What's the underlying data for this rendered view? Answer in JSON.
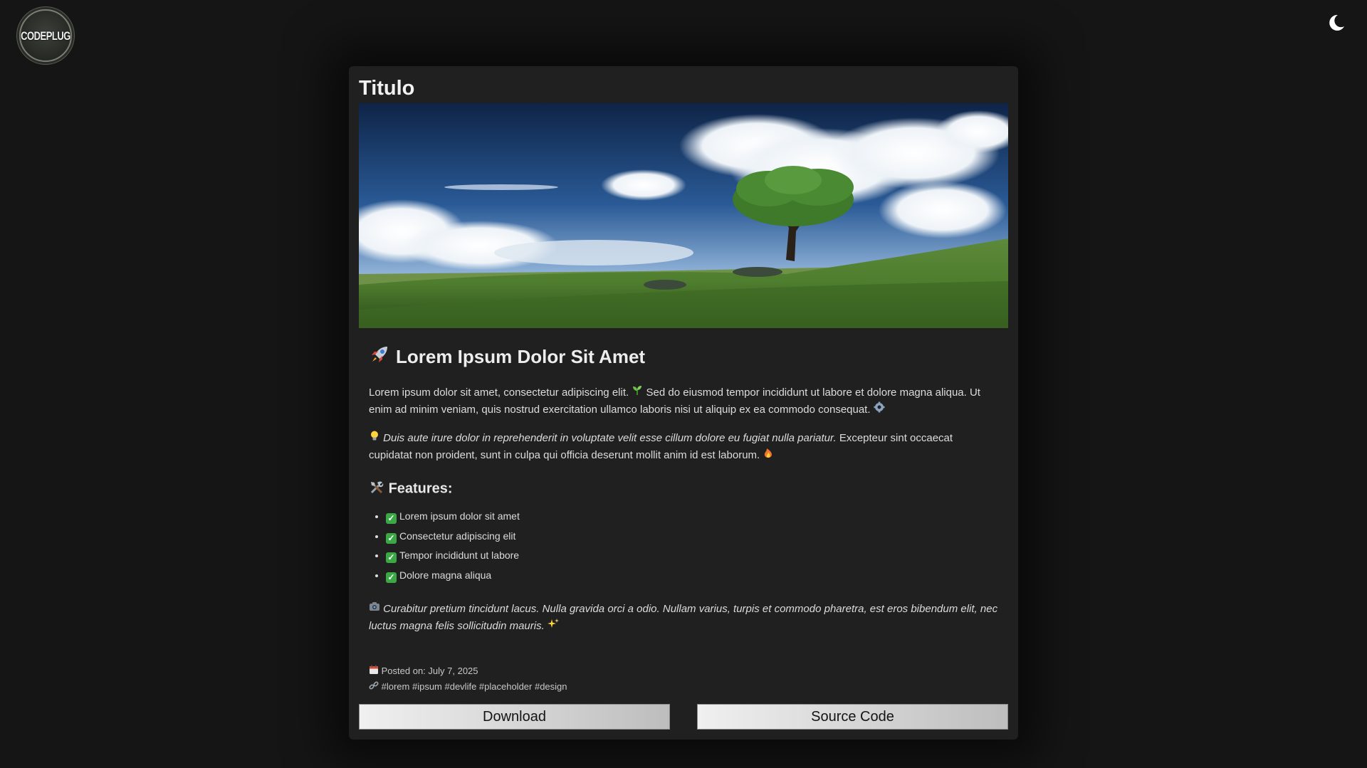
{
  "header": {
    "logo_text": "CODEPLUG",
    "theme_toggle_icon": "moon-icon"
  },
  "card": {
    "title": "Titulo",
    "hero_image": "landscape with tree on grassy hill under blue sky",
    "post": {
      "title": "Lorem Ipsum Dolor Sit Amet",
      "title_icon": "rocket-icon",
      "paragraph1_a": "Lorem ipsum dolor sit amet, consectetur adipiscing elit.",
      "paragraph1_b": "Sed do eiusmod tempor incididunt ut labore et dolore magna aliqua. Ut enim ad minim veniam, quis nostrud exercitation ullamco laboris nisi ut aliquip ex ea commodo consequat.",
      "paragraph2_em": "Duis aute irure dolor in reprehenderit in voluptate velit esse cillum dolore eu fugiat nulla pariatur.",
      "paragraph2_rest": "Excepteur sint occaecat cupidatat non proident, sunt in culpa qui officia deserunt mollit anim id est laborum.",
      "features_title": "Features:",
      "features": [
        "Lorem ipsum dolor sit amet",
        "Consectetur adipiscing elit",
        "Tempor incididunt ut labore",
        "Dolore magna aliqua"
      ],
      "paragraph3_em": "Curabitur pretium tincidunt lacus. Nulla gravida orci a odio. Nullam varius, turpis et commodo pharetra, est eros bibendum elit, nec luctus magna felis sollicitudin mauris.",
      "posted_label": "Posted on:",
      "posted_date": "July 7, 2025",
      "tags": "#lorem #ipsum #devlife #placeholder #design"
    },
    "buttons": {
      "download": "Download",
      "source_code": "Source Code"
    }
  },
  "colors": {
    "page_bg": "#151515",
    "card_bg": "#202020",
    "text": "#dcdcdc"
  }
}
